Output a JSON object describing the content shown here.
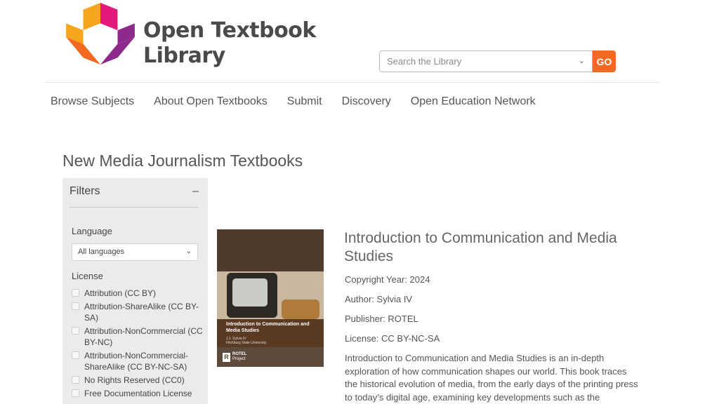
{
  "header": {
    "logo_line1": "Open Textbook",
    "logo_line2": "Library",
    "search_placeholder": "Search the Library",
    "go_label": "GO",
    "colors": {
      "accent": "#f26a21"
    }
  },
  "nav": {
    "items": [
      "Browse Subjects",
      "About Open Textbooks",
      "Submit",
      "Discovery",
      "Open Education Network"
    ]
  },
  "page": {
    "title": "New Media Journalism Textbooks"
  },
  "filters": {
    "title": "Filters",
    "toggle": "–",
    "language_label": "Language",
    "language_selected": "All languages",
    "license_label": "License",
    "licenses": [
      "Attribution (CC BY)",
      "Attribution-ShareAlike (CC BY-SA)",
      "Attribution-NonCommercial (CC BY-NC)",
      "Attribution-NonCommercial-ShareAlike (CC BY-NC-SA)",
      "No Rights Reserved (CC0)",
      "Free Documentation License"
    ]
  },
  "book": {
    "title": "Introduction to Communication and Media Studies",
    "copyright": "Copyright Year: 2024",
    "author": "Author: Sylvia IV",
    "publisher": "Publisher: ROTEL",
    "license": "License: CC BY-NC-SA",
    "description": "Introduction to Communication and Media Studies is an in-depth exploration of how communication shapes our world. This book traces the historical evolution of media, from the early days of the printing press to today’s digital age, examining key developments such as the",
    "cover": {
      "title": "Introduction to Communication and Media Studies",
      "author": "J.J. Sylvia IV",
      "institution": "Fitchburg State University",
      "badge_line1": "ROTEL",
      "badge_line2": "Project"
    }
  }
}
